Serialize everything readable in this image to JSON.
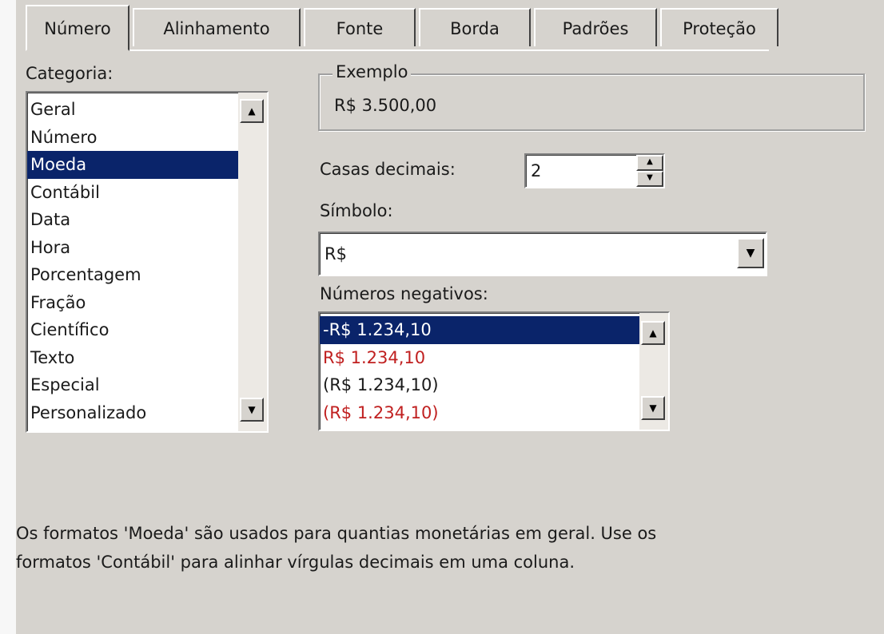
{
  "tabs": [
    {
      "label": "Número",
      "active": true
    },
    {
      "label": "Alinhamento",
      "active": false
    },
    {
      "label": "Fonte",
      "active": false
    },
    {
      "label": "Borda",
      "active": false
    },
    {
      "label": "Padrões",
      "active": false
    },
    {
      "label": "Proteção",
      "active": false
    }
  ],
  "category": {
    "label": "Categoria:",
    "items": [
      "Geral",
      "Número",
      "Moeda",
      "Contábil",
      "Data",
      "Hora",
      "Porcentagem",
      "Fração",
      "Científico",
      "Texto",
      "Especial",
      "Personalizado"
    ],
    "selected": "Moeda"
  },
  "example": {
    "title": "Exemplo",
    "value": "R$ 3.500,00"
  },
  "decimals": {
    "label": "Casas decimais:",
    "value": "2"
  },
  "symbol": {
    "label": "Símbolo:",
    "value": "R$"
  },
  "negative_numbers": {
    "label": "Números negativos:",
    "items": [
      {
        "text": "-R$ 1.234,10",
        "color": "#ffffff",
        "selected": true
      },
      {
        "text": "R$ 1.234,10",
        "color": "#c02020",
        "selected": false
      },
      {
        "text": "(R$ 1.234,10)",
        "color": "#1a1a1a",
        "selected": false
      },
      {
        "text": "(R$ 1.234,10)",
        "color": "#c02020",
        "selected": false
      }
    ]
  },
  "description": {
    "line1": "Os formatos 'Moeda' são usados para quantias monetárias em geral. Use os",
    "line2": "formatos 'Contábil' para alinhar vírgulas decimais em uma coluna."
  },
  "icons": {
    "scroll_up": "scroll-up-arrow-icon",
    "scroll_down": "scroll-down-arrow-icon",
    "dropdown": "dropdown-arrow-icon"
  }
}
